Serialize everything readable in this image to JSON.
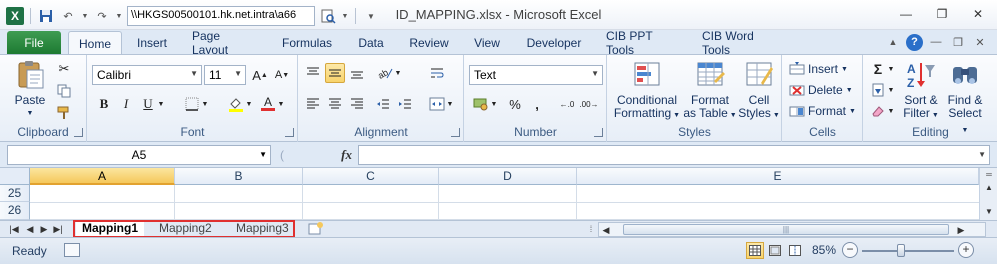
{
  "window": {
    "title": "ID_MAPPING.xlsx  -  Microsoft Excel",
    "path": "\\\\HKGS00500101.hk.net.intra\\a66"
  },
  "tabs": {
    "file": "File",
    "items": [
      "Home",
      "Insert",
      "Page Layout",
      "Formulas",
      "Data",
      "Review",
      "View",
      "Developer",
      "CIB PPT Tools",
      "CIB Word Tools"
    ],
    "active": "Home"
  },
  "ribbon": {
    "clipboard": {
      "label": "Clipboard",
      "paste": "Paste"
    },
    "font": {
      "label": "Font",
      "name": "Calibri",
      "size": "11"
    },
    "alignment": {
      "label": "Alignment"
    },
    "number": {
      "label": "Number",
      "format": "Text",
      "percent": "%",
      "comma": ","
    },
    "styles": {
      "label": "Styles",
      "conditional_1": "Conditional",
      "conditional_2": "Formatting",
      "format_table_1": "Format",
      "format_table_2": "as Table",
      "cell_styles_1": "Cell",
      "cell_styles_2": "Styles"
    },
    "cells": {
      "label": "Cells",
      "insert": "Insert",
      "delete": "Delete",
      "format": "Format"
    },
    "editing": {
      "label": "Editing",
      "sort_1": "Sort &",
      "sort_2": "Filter",
      "find_1": "Find &",
      "find_2": "Select"
    }
  },
  "formula_bar": {
    "name_box": "A5",
    "fx": "fx",
    "value": ""
  },
  "grid": {
    "columns": [
      "A",
      "B",
      "C",
      "D",
      "E"
    ],
    "selected_column": "A",
    "rows": [
      "25",
      "26"
    ]
  },
  "sheets": {
    "tabs": [
      "Mapping1",
      "Mapping2",
      "Mapping3"
    ],
    "active": "Mapping1"
  },
  "status": {
    "ready": "Ready",
    "zoom": "85%",
    "zoom_fraction": 0.85
  },
  "colors": {
    "file_tab": "#2a8a3e",
    "highlight": "#f8d36b",
    "sheet_outline": "#e03030"
  }
}
